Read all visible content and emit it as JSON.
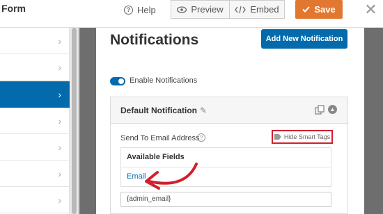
{
  "header": {
    "title": "Form",
    "help_label": "Help",
    "preview_label": "Preview",
    "embed_label": "Embed",
    "save_label": "Save"
  },
  "sidebar": {
    "items": [
      {
        "active": false
      },
      {
        "active": false
      },
      {
        "active": true
      },
      {
        "active": false
      },
      {
        "active": false
      },
      {
        "active": false
      },
      {
        "active": false
      }
    ]
  },
  "panel": {
    "title": "Notifications",
    "add_button_label": "Add New Notification",
    "enable_label": "Enable Notifications",
    "notification": {
      "title": "Default Notification",
      "send_to_label": "Send To Email Address",
      "smart_tags_label": "Hide Smart Tags",
      "available_fields_title": "Available Fields",
      "field_email": "Email",
      "email_value": "{admin_email}"
    }
  },
  "colors": {
    "accent_blue": "#036aab",
    "save_orange": "#e27730",
    "highlight_red": "#d0202e"
  },
  "icons": [
    "question-icon",
    "eye-icon",
    "code-icon",
    "check-icon",
    "close-icon",
    "chevron-right-icon",
    "pencil-icon",
    "clone-icon",
    "chevron-up-icon",
    "tag-icon",
    "arrow-annotation"
  ]
}
